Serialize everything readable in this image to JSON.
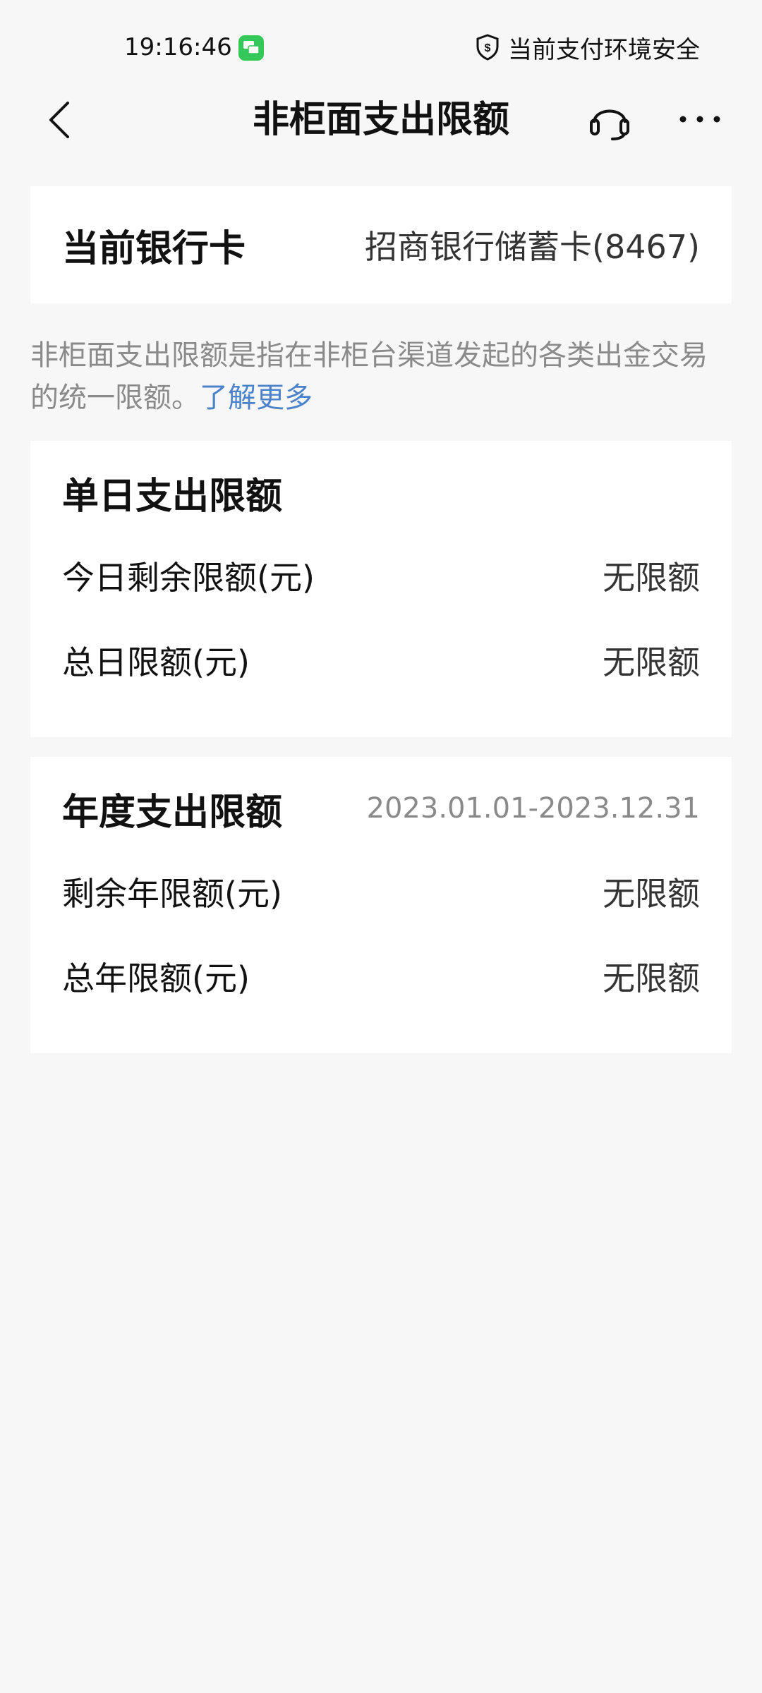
{
  "status_bar": {
    "time": "19:16:46",
    "security_text": "当前支付环境安全",
    "icons": [
      "message-icon",
      "shield-icon"
    ]
  },
  "nav": {
    "title": "非柜面支出限额",
    "icons": [
      "back-arrow-icon",
      "headset-icon",
      "more-icon"
    ]
  },
  "current_card": {
    "label": "当前银行卡",
    "value": "招商银行储蓄卡(8467)"
  },
  "description": {
    "text": "非柜面支出限额是指在非柜台渠道发起的各类出金交易的统一限额。",
    "link": "了解更多"
  },
  "daily_limit": {
    "title": "单日支出限额",
    "rows": [
      {
        "label": "今日剩余限额(元)",
        "value": "无限额"
      },
      {
        "label": "总日限额(元)",
        "value": "无限额"
      }
    ]
  },
  "annual_limit": {
    "title": "年度支出限额",
    "period": "2023.01.01-2023.12.31",
    "rows": [
      {
        "label": "剩余年限额(元)",
        "value": "无限额"
      },
      {
        "label": "总年限额(元)",
        "value": "无限额"
      }
    ]
  },
  "colors": {
    "background": "#f7f7f7",
    "card": "#ffffff",
    "link": "#4b82c9",
    "secondary_text": "#8a8a8a",
    "message_icon": "#34c85a"
  }
}
